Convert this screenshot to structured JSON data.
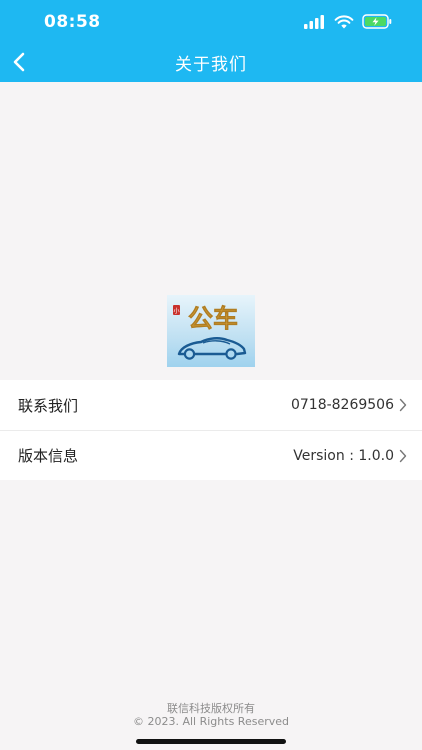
{
  "status_bar": {
    "time": "08:58",
    "icons": [
      "signal-icon",
      "wifi-icon",
      "battery-charging-icon"
    ]
  },
  "nav": {
    "title": "关于我们",
    "back_icon": "back-arrow-icon"
  },
  "logo": {
    "text": "公车",
    "seal_text": "小"
  },
  "list": {
    "items": [
      {
        "label": "联系我们",
        "value": "0718-8269506",
        "icon": "chevron-right-icon"
      },
      {
        "label": "版本信息",
        "value": "Version : 1.0.0",
        "icon": "chevron-right-icon"
      }
    ]
  },
  "footer": {
    "line1": "联信科技版权所有",
    "line2": "© 2023. All Rights Reserved"
  },
  "colors": {
    "header": "#1eb8f2",
    "background": "#f6f4f5",
    "row_bg": "#ffffff",
    "footer_text": "#8c8c8c"
  }
}
